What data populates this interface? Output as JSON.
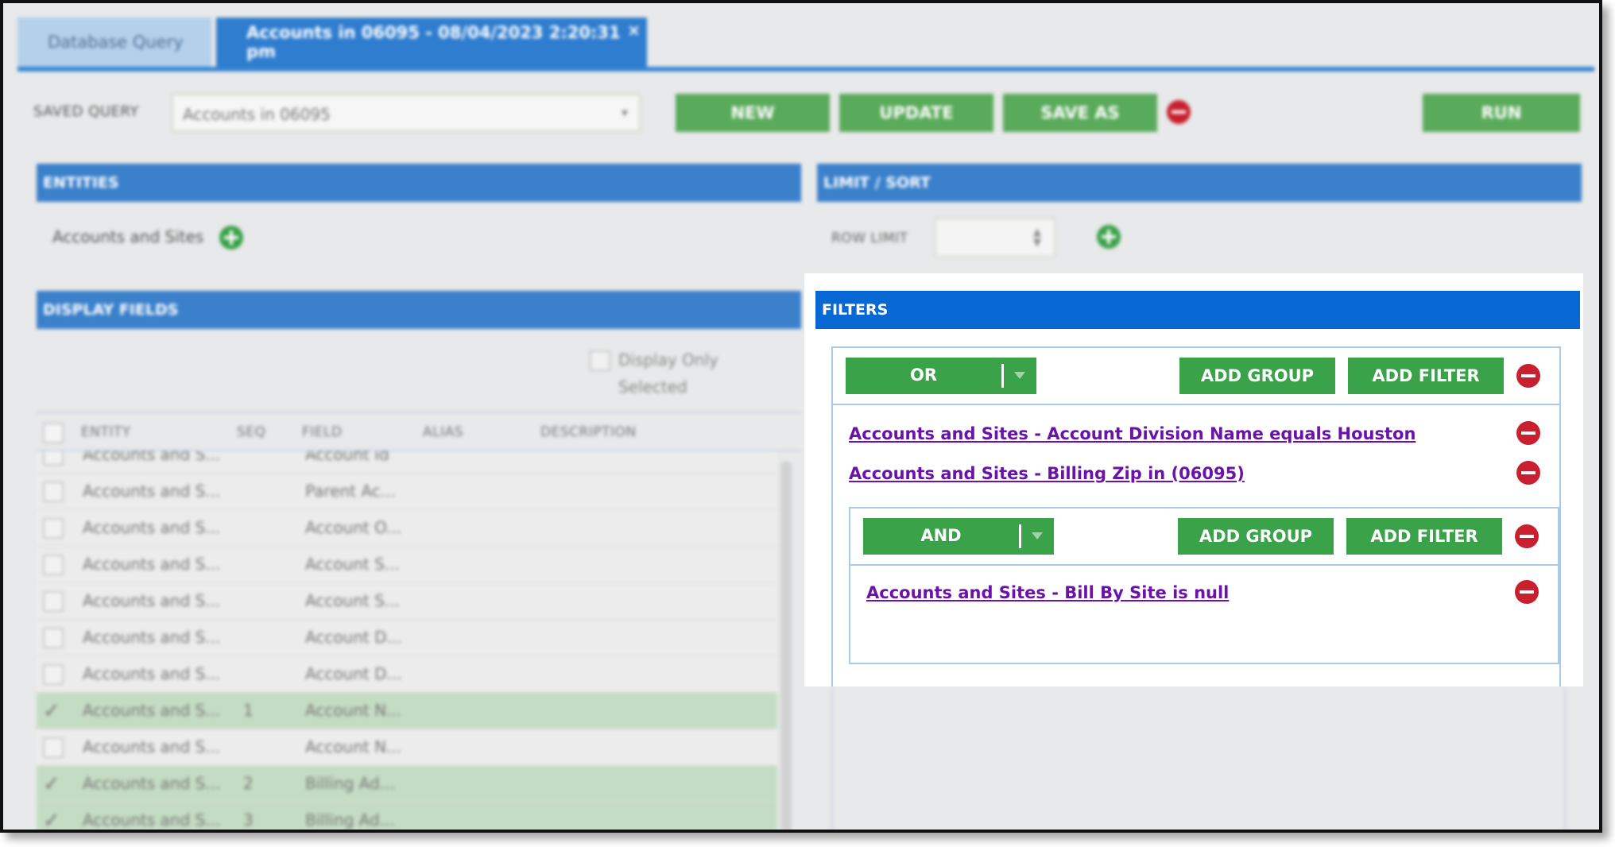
{
  "tabs": [
    {
      "label": "Database Query"
    },
    {
      "label": "Accounts in 06095 - 08/04/2023 2:20:31 pm",
      "close": "×"
    }
  ],
  "saved_query": {
    "label": "SAVED QUERY",
    "value": "Accounts in 06095",
    "buttons": {
      "new": "NEW",
      "update": "UPDATE",
      "save_as": "SAVE AS",
      "run": "RUN"
    }
  },
  "entities": {
    "title": "ENTITIES",
    "item": "Accounts and Sites"
  },
  "limit_sort": {
    "title": "LIMIT / SORT",
    "row_limit_label": "ROW LIMIT",
    "row_limit_value": ""
  },
  "display_fields": {
    "title": "DISPLAY FIELDS",
    "display_only_selected": "Display Only Selected",
    "columns": [
      "ENTITY",
      "SEQ",
      "FIELD",
      "ALIAS",
      "DESCRIPTION"
    ],
    "rows": [
      {
        "entity": "Accounts and S...",
        "seq": "",
        "field": "Account Id",
        "checked": false
      },
      {
        "entity": "Accounts and S...",
        "seq": "",
        "field": "Parent Ac...",
        "checked": false
      },
      {
        "entity": "Accounts and S...",
        "seq": "",
        "field": "Account O...",
        "checked": false
      },
      {
        "entity": "Accounts and S...",
        "seq": "",
        "field": "Account S...",
        "checked": false
      },
      {
        "entity": "Accounts and S...",
        "seq": "",
        "field": "Account S...",
        "checked": false
      },
      {
        "entity": "Accounts and S...",
        "seq": "",
        "field": "Account D...",
        "checked": false
      },
      {
        "entity": "Accounts and S...",
        "seq": "",
        "field": "Account D...",
        "checked": false
      },
      {
        "entity": "Accounts and S...",
        "seq": "1",
        "field": "Account N...",
        "checked": true
      },
      {
        "entity": "Accounts and S...",
        "seq": "",
        "field": "Account N...",
        "checked": false
      },
      {
        "entity": "Accounts and S...",
        "seq": "2",
        "field": "Billing Ad...",
        "checked": true
      },
      {
        "entity": "Accounts and S...",
        "seq": "3",
        "field": "Billing Ad...",
        "checked": true
      }
    ]
  },
  "filters": {
    "title": "FILTERS",
    "or_group": {
      "operator": "OR",
      "add_group": "ADD GROUP",
      "add_filter": "ADD FILTER",
      "conditions": [
        "Accounts and Sites - Account Division Name equals Houston",
        "Accounts and Sites - Billing Zip in (06095)"
      ]
    },
    "and_group": {
      "operator": "AND",
      "add_group": "ADD GROUP",
      "add_filter": "ADD FILTER",
      "conditions": [
        "Accounts and Sites - Bill By Site is null"
      ]
    }
  },
  "colors": {
    "primary_blue": "#0868d3",
    "green": "#3aa34a",
    "danger_red": "#c8202e",
    "link_purple": "#6b12a8"
  }
}
